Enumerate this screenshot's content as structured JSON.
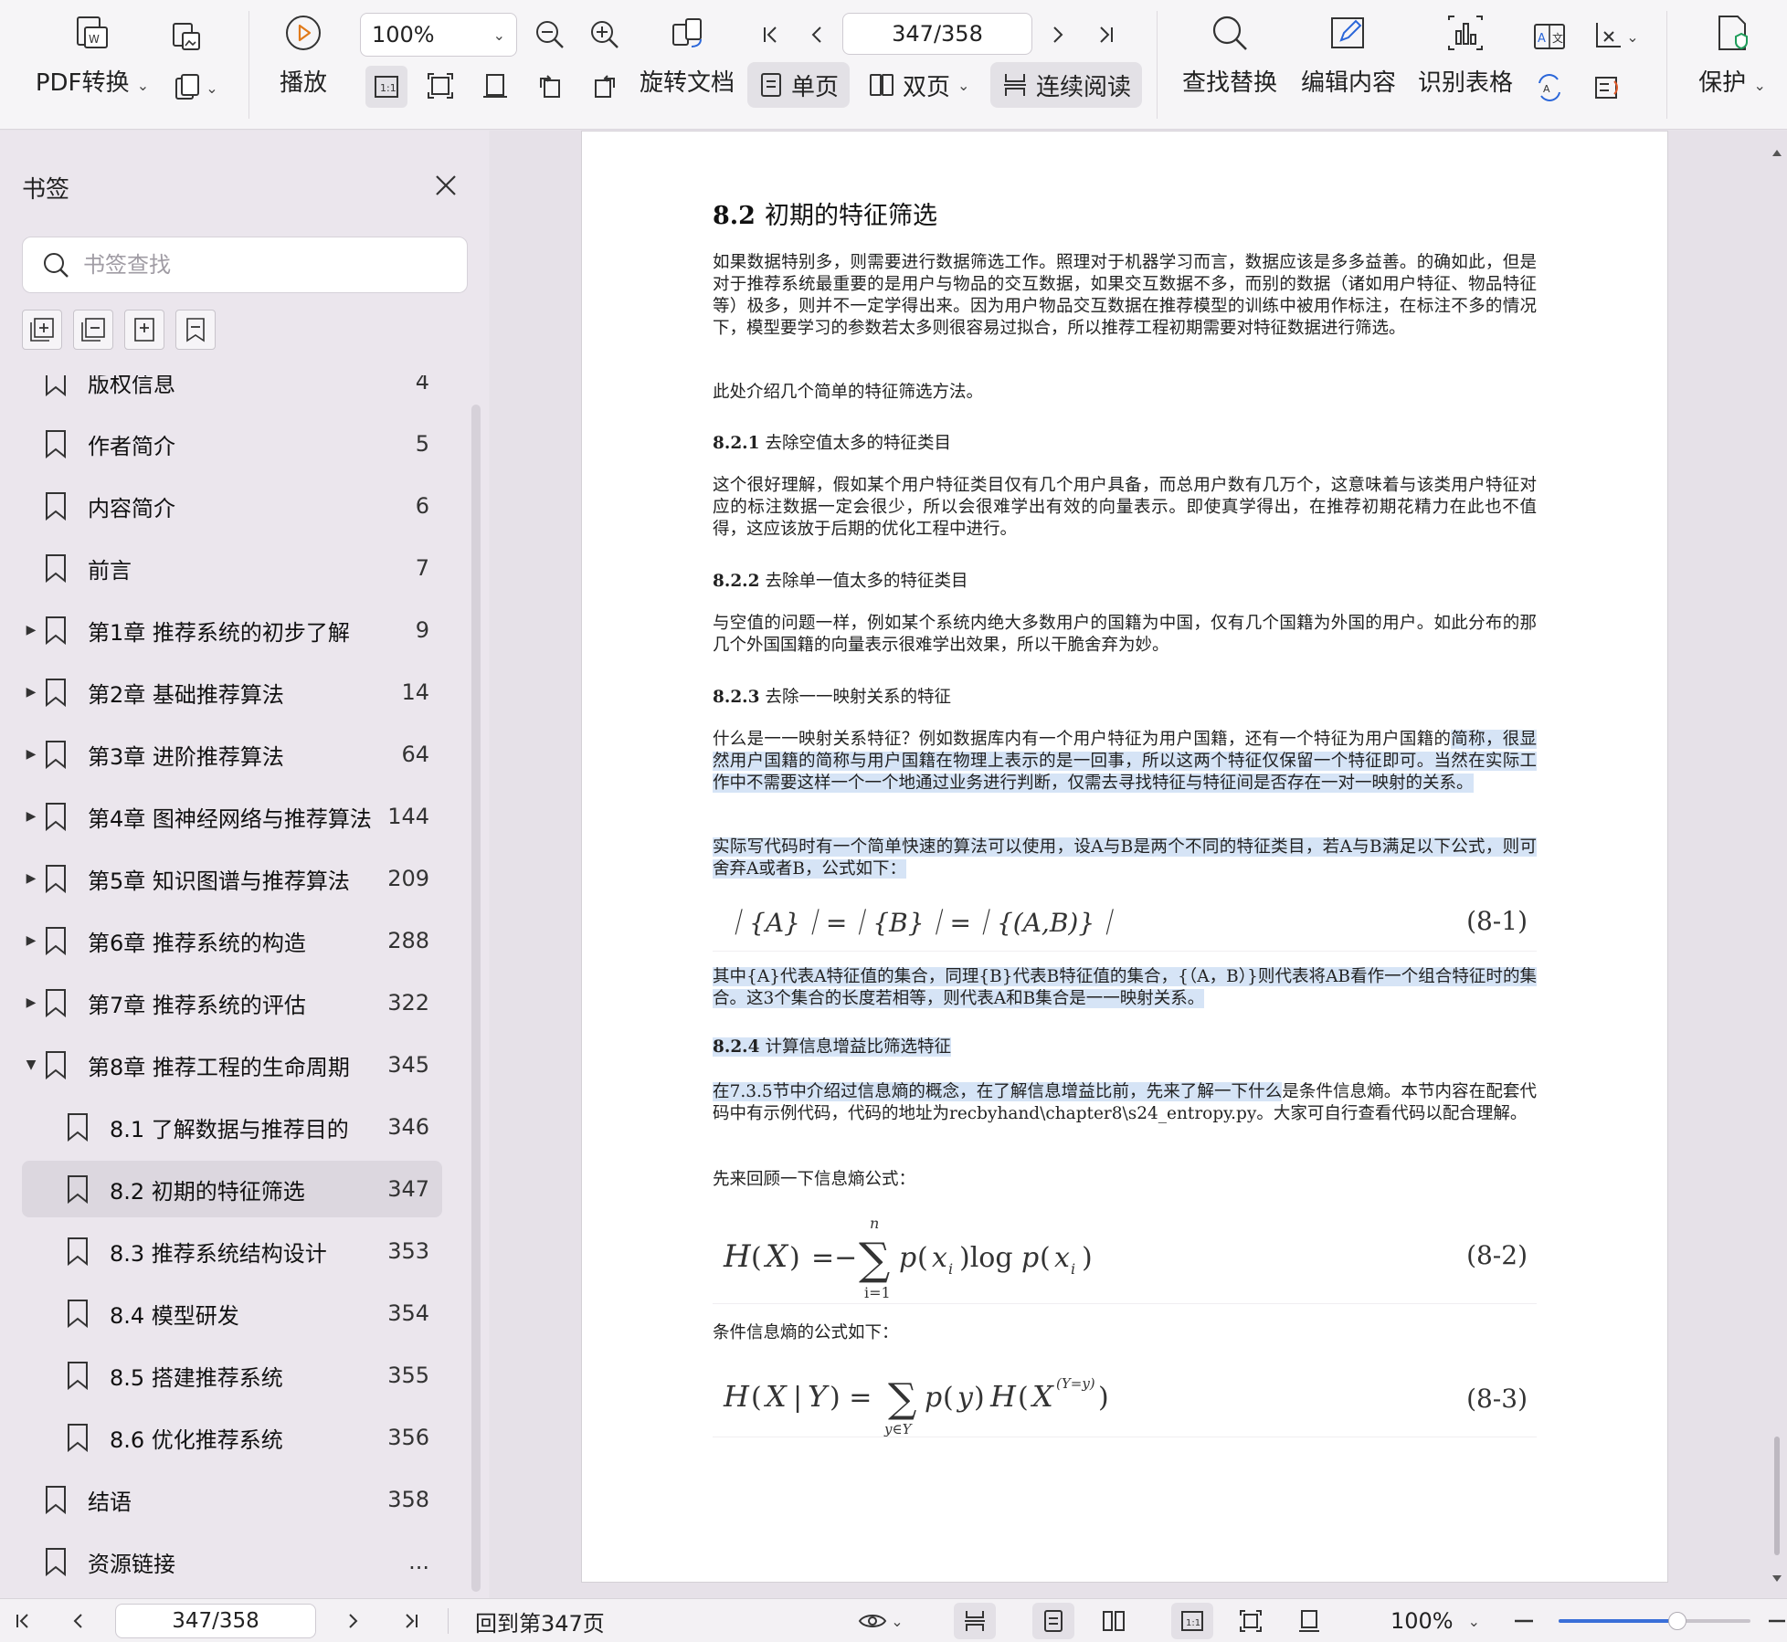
{
  "toolbar": {
    "pdf_convert": "PDF转换",
    "play": "播放",
    "zoom": "100%",
    "rotate": "旋转文档",
    "single_page": "单页",
    "double_page": "双页",
    "continuous": "连续阅读",
    "page_indicator": "347/358",
    "find_replace": "查找替换",
    "edit_content": "编辑内容",
    "recognize_table": "识别表格",
    "protect": "保护"
  },
  "sidebar": {
    "title": "书签",
    "search_placeholder": "书签查找",
    "items": [
      {
        "label": "版权信息",
        "page": "4",
        "expandable": false,
        "level": 0
      },
      {
        "label": "作者简介",
        "page": "5",
        "expandable": false,
        "level": 0
      },
      {
        "label": "内容简介",
        "page": "6",
        "expandable": false,
        "level": 0
      },
      {
        "label": "前言",
        "page": "7",
        "expandable": false,
        "level": 0
      },
      {
        "label": "第1章 推荐系统的初步了解",
        "page": "9",
        "expandable": true,
        "level": 0
      },
      {
        "label": "第2章 基础推荐算法",
        "page": "14",
        "expandable": true,
        "level": 0
      },
      {
        "label": "第3章 进阶推荐算法",
        "page": "64",
        "expandable": true,
        "level": 0
      },
      {
        "label": "第4章 图神经网络与推荐算法",
        "page": "144",
        "expandable": true,
        "level": 0
      },
      {
        "label": "第5章 知识图谱与推荐算法",
        "page": "209",
        "expandable": true,
        "level": 0
      },
      {
        "label": "第6章 推荐系统的构造",
        "page": "288",
        "expandable": true,
        "level": 0
      },
      {
        "label": "第7章 推荐系统的评估",
        "page": "322",
        "expandable": true,
        "level": 0
      },
      {
        "label": "第8章 推荐工程的生命周期",
        "page": "345",
        "expandable": true,
        "expanded": true,
        "level": 0
      },
      {
        "label": "8.1 了解数据与推荐目的",
        "page": "346",
        "expandable": false,
        "level": 1
      },
      {
        "label": "8.2 初期的特征筛选",
        "page": "347",
        "expandable": false,
        "level": 1,
        "selected": true
      },
      {
        "label": "8.3 推荐系统结构设计",
        "page": "353",
        "expandable": false,
        "level": 1
      },
      {
        "label": "8.4 模型研发",
        "page": "354",
        "expandable": false,
        "level": 1
      },
      {
        "label": "8.5 搭建推荐系统",
        "page": "355",
        "expandable": false,
        "level": 1
      },
      {
        "label": "8.6 优化推荐系统",
        "page": "356",
        "expandable": false,
        "level": 1
      },
      {
        "label": "结语",
        "page": "358",
        "expandable": false,
        "level": 0
      },
      {
        "label": "资源链接",
        "page": "...",
        "expandable": false,
        "level": 0
      }
    ]
  },
  "document": {
    "h1_num": "8.2",
    "h1_text": "初期的特征筛选",
    "p1": "如果数据特别多，则需要进行数据筛选工作。照理对于机器学习而言，数据应该是多多益善。的确如此，但是对于推荐系统最重要的是用户与物品的交互数据，如果交互数据不多，而别的数据（诸如用户特征、物品特征等）极多，则并不一定学得出来。因为用户物品交互数据在推荐模型的训练中被用作标注，在标注不多的情况下，模型要学习的参数若太多则很容易过拟合，所以推荐工程初期需要对特征数据进行筛选。",
    "p2": "此处介绍几个简单的特征筛选方法。",
    "s1_num": "8.2.1",
    "s1_text": "去除空值太多的特征类目",
    "p3": "这个很好理解，假如某个用户特征类目仅有几个用户具备，而总用户数有几万个，这意味着与该类用户特征对应的标注数据一定会很少，所以会很难学出有效的向量表示。即使真学得出，在推荐初期花精力在此也不值得，这应该放于后期的优化工程中进行。",
    "s2_num": "8.2.2",
    "s2_text": "去除单一值太多的特征类目",
    "p4": "与空值的问题一样，例如某个系统内绝大多数用户的国籍为中国，仅有几个国籍为外国的用户。如此分布的那几个外国国籍的向量表示很难学出效果，所以干脆舍弃为妙。",
    "s3_num": "8.2.3",
    "s3_text": "去除一一映射关系的特征",
    "p5a": "什么是一一映射关系特征？例如数据库内有一个用户特征为用户国籍，还有一个特征为用户国籍的",
    "p5b": "简称，很显然用户国籍的简称与用户国籍在物理上表示的是一回事，所以这两个特征仅保留一个特征即可。当然在实际工作中不需要这样一个一个地通过业务进行判断，仅需去寻找特征与特征间是否存在一对一映射的关系。",
    "p6": "实际写代码时有一个简单快速的算法可以使用，设A与B是两个不同的特征类目，若A与B满足以下公式，则可舍弃A或者B，公式如下：",
    "f1": "｜{A}｜=｜{B}｜=｜{(A,B)}｜",
    "f1_num": "(8-1)",
    "p7": "其中{A}代表A特征值的集合，同理{B}代表B特征值的集合，{（A，B）}则代表将AB看作一个组合特征时的集合。这3个集合的长度若相等，则代表A和B集合是一一映射关系。",
    "s4_num": "8.2.4",
    "s4_text": "计算信息增益比筛选特征",
    "p8a": "在7.3.5节中介绍过信息熵的概念，在了解信息增益比前，先来了解一下什么",
    "p8b": "是条件信息熵。本节内容在配套代码中有示例代码，代码的地址为recbyhand\\chapter8\\s24_entropy.py。大家可自行查看代码以配合理解。",
    "p9": "先来回顾一下信息熵公式：",
    "f2_num": "(8-2)",
    "p10": "条件信息熵的公式如下：",
    "f3_num": "(8-3)"
  },
  "statusbar": {
    "page": "347/358",
    "goto": "回到第347页",
    "zoom": "100%",
    "zoom_fraction": 0.62
  }
}
